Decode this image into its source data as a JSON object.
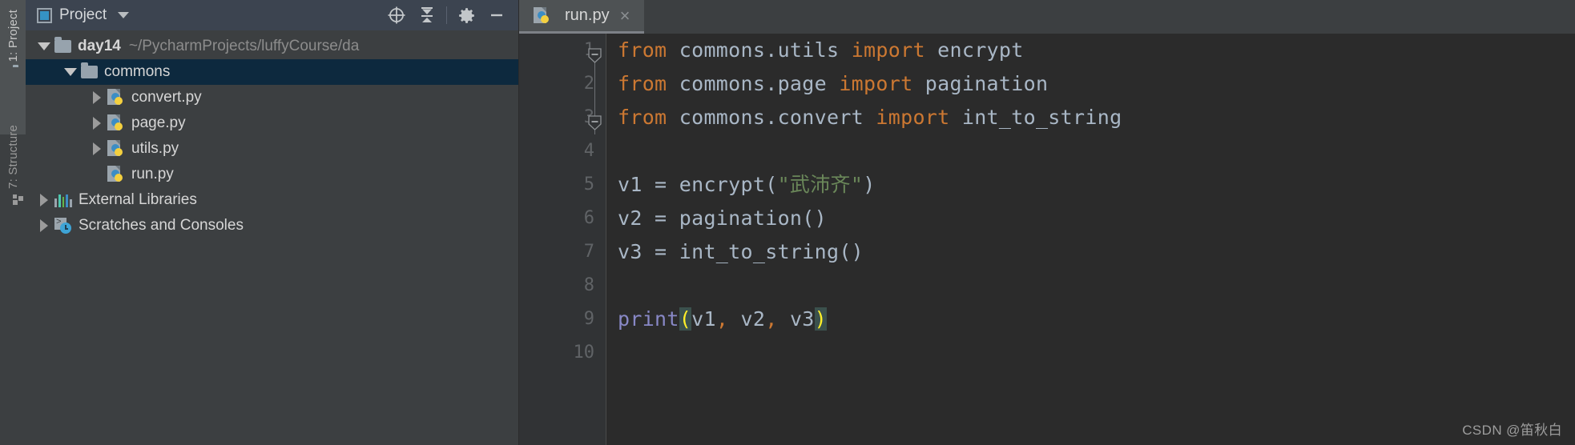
{
  "tool_strip": {
    "tabs": [
      {
        "label": "1: Project",
        "icon": "folder-icon",
        "active": true
      },
      {
        "label": "7: Structure",
        "icon": "structure-icon",
        "active": false
      }
    ]
  },
  "project_panel": {
    "header": {
      "title": "Project",
      "dropdown_caret": "chevron-down-icon",
      "actions": [
        {
          "name": "locate-icon",
          "tooltip": "Select Opened File"
        },
        {
          "name": "collapse-all-icon",
          "tooltip": "Collapse All"
        },
        {
          "name": "gear-icon",
          "tooltip": "Settings"
        },
        {
          "name": "minimize-icon",
          "tooltip": "Hide"
        }
      ]
    },
    "tree": [
      {
        "name": "day14",
        "path": "~/PycharmProjects/luffyCourse/da",
        "icon": "folder-icon",
        "twisty": "expanded",
        "indent": 0,
        "bold": true,
        "selected": false
      },
      {
        "name": "commons",
        "path": "",
        "icon": "folder-icon",
        "twisty": "expanded",
        "indent": 1,
        "bold": false,
        "selected": true
      },
      {
        "name": "convert.py",
        "path": "",
        "icon": "python-file-icon",
        "twisty": "collapsed",
        "indent": 2,
        "bold": false,
        "selected": false
      },
      {
        "name": "page.py",
        "path": "",
        "icon": "python-file-icon",
        "twisty": "collapsed",
        "indent": 2,
        "bold": false,
        "selected": false
      },
      {
        "name": "utils.py",
        "path": "",
        "icon": "python-file-icon",
        "twisty": "collapsed",
        "indent": 2,
        "bold": false,
        "selected": false
      },
      {
        "name": "run.py",
        "path": "",
        "icon": "python-file-icon",
        "twisty": "none",
        "indent": 2,
        "bold": false,
        "selected": false
      },
      {
        "name": "External Libraries",
        "path": "",
        "icon": "external-libraries-icon",
        "twisty": "collapsed",
        "indent": 0,
        "bold": false,
        "selected": false
      },
      {
        "name": "Scratches and Consoles",
        "path": "",
        "icon": "scratches-icon",
        "twisty": "collapsed",
        "indent": 0,
        "bold": false,
        "selected": false
      }
    ]
  },
  "editor": {
    "tabs": [
      {
        "label": "run.py",
        "icon": "python-file-icon",
        "close": "×",
        "active": true
      }
    ],
    "line_numbers": [
      "1",
      "2",
      "3",
      "4",
      "5",
      "6",
      "7",
      "8",
      "9",
      "10"
    ],
    "fold_markers": [
      {
        "line": 1,
        "state": "expanded"
      },
      {
        "line": 3,
        "state": "expanded"
      }
    ],
    "lines": [
      {
        "n": 1,
        "tokens": [
          {
            "t": "from",
            "c": "kw"
          },
          {
            "t": " commons.utils ",
            "c": "plain"
          },
          {
            "t": "import",
            "c": "kw"
          },
          {
            "t": " encrypt",
            "c": "plain"
          }
        ]
      },
      {
        "n": 2,
        "tokens": [
          {
            "t": "from",
            "c": "kw"
          },
          {
            "t": " commons.page ",
            "c": "plain"
          },
          {
            "t": "import",
            "c": "kw"
          },
          {
            "t": " pagination",
            "c": "plain"
          }
        ]
      },
      {
        "n": 3,
        "tokens": [
          {
            "t": "from",
            "c": "kw"
          },
          {
            "t": " commons.convert ",
            "c": "plain"
          },
          {
            "t": "import",
            "c": "kw"
          },
          {
            "t": " int_to_string",
            "c": "plain"
          }
        ]
      },
      {
        "n": 4,
        "tokens": []
      },
      {
        "n": 5,
        "tokens": [
          {
            "t": "v1 = encrypt(",
            "c": "plain"
          },
          {
            "t": "\"武沛齐\"",
            "c": "str"
          },
          {
            "t": ")",
            "c": "plain"
          }
        ]
      },
      {
        "n": 6,
        "tokens": [
          {
            "t": "v2 = pagination()",
            "c": "plain"
          }
        ]
      },
      {
        "n": 7,
        "tokens": [
          {
            "t": "v3 = int_to_string()",
            "c": "plain"
          }
        ]
      },
      {
        "n": 8,
        "tokens": []
      },
      {
        "n": 9,
        "tokens": [
          {
            "t": "print",
            "c": "fn-builtin"
          },
          {
            "t": "(",
            "c": "brace-hl"
          },
          {
            "t": "v1",
            "c": "plain"
          },
          {
            "t": ",",
            "c": "comma"
          },
          {
            "t": " v2",
            "c": "plain"
          },
          {
            "t": ",",
            "c": "comma"
          },
          {
            "t": " v3",
            "c": "plain"
          },
          {
            "t": ")",
            "c": "brace-hl"
          }
        ]
      },
      {
        "n": 10,
        "tokens": []
      }
    ]
  },
  "watermark": {
    "text": "CSDN @笛秋白"
  },
  "colors": {
    "editor_bg": "#2B2B2B",
    "panel_bg": "#3C3F41",
    "header_bg": "#3C4450",
    "selection_bg": "#0D293E",
    "keyword": "#CC7832",
    "string": "#6A8759",
    "builtin": "#8888C6",
    "brace_highlight_fg": "#FFEF28",
    "brace_highlight_bg": "#3B514D",
    "text": "#A9B7C6",
    "line_number": "#606366",
    "accent": "#3592C4"
  }
}
